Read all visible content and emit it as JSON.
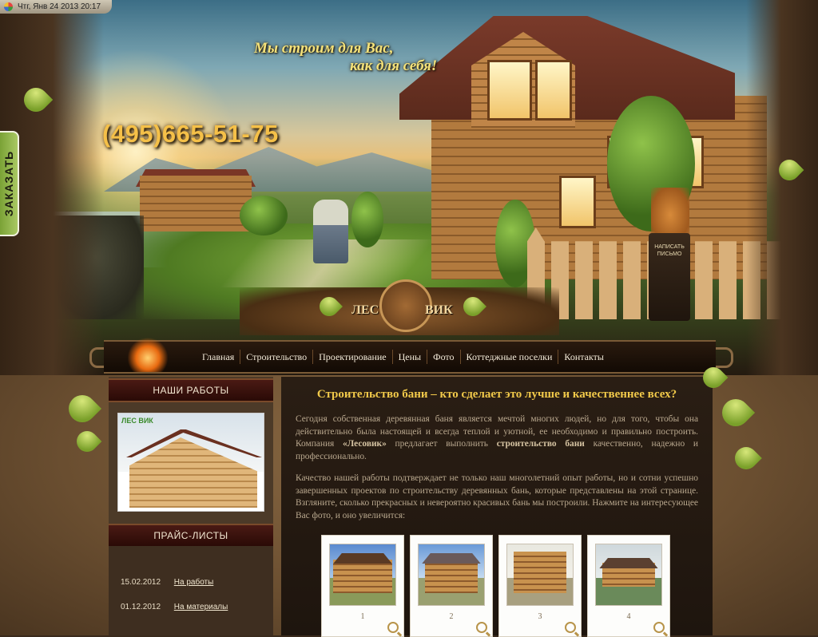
{
  "status": {
    "datetime": "Чтг, Янв 24 2013 20:17"
  },
  "order_tab": {
    "label": "ЗАКАЗАТЬ"
  },
  "hero": {
    "slogan_line1": "Мы строим для Вас,",
    "slogan_line2": "как для себя!",
    "phone": "(495)665-51-75",
    "mailbox_label": "НАПИСАТЬ ПИСЬМО"
  },
  "logo": {
    "left": "ЛЕС",
    "right": "ВИК"
  },
  "nav": {
    "items": [
      {
        "label": "Главная"
      },
      {
        "label": "Строительство"
      },
      {
        "label": "Проектирование"
      },
      {
        "label": "Цены"
      },
      {
        "label": "Фото"
      },
      {
        "label": "Коттеджные поселки"
      },
      {
        "label": "Контакты"
      }
    ]
  },
  "sidebar": {
    "works_title": "НАШИ РАБОТЫ",
    "works_image_logo": "ЛЕС ВИК",
    "price_title": "ПРАЙС-ЛИСТЫ",
    "price_items": [
      {
        "date": "15.02.2012",
        "label": "На работы"
      },
      {
        "date": "01.12.2012",
        "label": "На материалы"
      }
    ]
  },
  "content": {
    "title": "Строительство бани – кто сделает это лучше и качественнее всех?",
    "para1_a": "Сегодня собственная деревянная баня является мечтой многих людей, но для того, чтобы она действительно была настоящей и всегда теплой и уютной, ее необходимо и правильно построить. Компания ",
    "para1_company": "«Лесовик»",
    "para1_b": " предлагает выполнить ",
    "para1_service": "строительство бани",
    "para1_c": " качественно, надежно и профессионально.",
    "para2": "Качество нашей работы подтверждает не только наш многолетний опыт работы, но и сотни успешно завершенных проектов по строительству деревянных бань, которые представлены на этой странице. Взгляните, сколько прекрасных и невероятно красивых бань мы построили. Нажмите на интересующее Вас фото, и оно увеличится:",
    "thumbs": [
      {
        "num": "1"
      },
      {
        "num": "2"
      },
      {
        "num": "3"
      },
      {
        "num": "4"
      }
    ]
  }
}
